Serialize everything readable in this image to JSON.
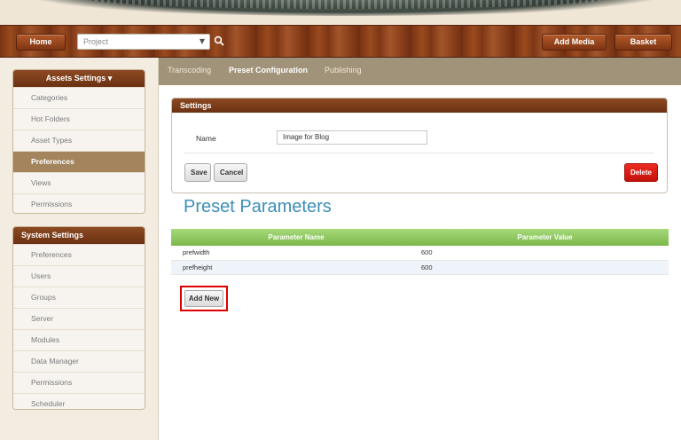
{
  "header": {
    "home_label": "Home",
    "project_placeholder": "Project",
    "add_media_label": "Add Media",
    "basket_label": "Basket"
  },
  "sidebar": {
    "assets": {
      "title": "Assets Settings ▾",
      "items": [
        {
          "label": "Categories",
          "active": false
        },
        {
          "label": "Hot Folders",
          "active": false
        },
        {
          "label": "Asset Types",
          "active": false
        },
        {
          "label": "Preferences",
          "active": true
        },
        {
          "label": "Views",
          "active": false
        },
        {
          "label": "Permissions",
          "active": false
        }
      ]
    },
    "system": {
      "title": "System Settings",
      "items": [
        {
          "label": "Preferences"
        },
        {
          "label": "Users"
        },
        {
          "label": "Groups"
        },
        {
          "label": "Server"
        },
        {
          "label": "Modules"
        },
        {
          "label": "Data Manager"
        },
        {
          "label": "Permissions"
        },
        {
          "label": "Scheduler"
        }
      ]
    }
  },
  "tabs": [
    {
      "label": "Transcoding",
      "active": false
    },
    {
      "label": "Preset Configuration",
      "active": true
    },
    {
      "label": "Publishing",
      "active": false
    }
  ],
  "settings": {
    "title": "Settings",
    "name_label": "Name",
    "name_value": "Image for Blog",
    "save_label": "Save",
    "cancel_label": "Cancel",
    "delete_label": "Delete"
  },
  "parameters": {
    "title": "Preset Parameters",
    "columns": [
      "Parameter Name",
      "Parameter Value"
    ],
    "rows": [
      {
        "name": "prefwidth",
        "value": "600"
      },
      {
        "name": "prefheight",
        "value": "600"
      }
    ],
    "add_new_label": "Add New"
  },
  "colors": {
    "wood": "#8a4019",
    "panel_header": "#7a3a18",
    "active_item": "#a3845d",
    "tab_bar": "#a1937a",
    "table_header": "#8cc55c",
    "title_blue": "#3c8fb7",
    "delete_red": "#dd1d14",
    "highlight_red": "#e00000"
  }
}
